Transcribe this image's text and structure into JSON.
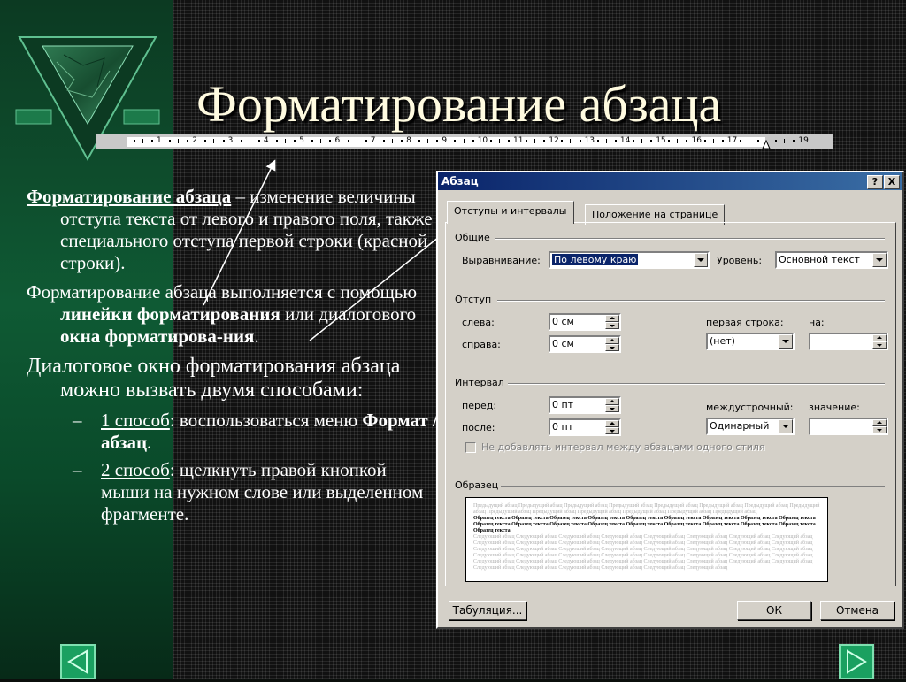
{
  "slide": {
    "title": "Форматирование абзаца",
    "ruler_numbers": [
      "1",
      "2",
      "3",
      "4",
      "5",
      "6",
      "7",
      "8",
      "9",
      "10",
      "11",
      "12",
      "13",
      "14",
      "15",
      "16",
      "17",
      "19"
    ],
    "p1_term": "Форматирование абзаца",
    "p1_rest": " – изменение величины отступа текста от левого и правого поля,  также специального отступа первой строки (красной строки).",
    "p2_a": "Форматирование абзаца выполняется с помощью ",
    "p2_b": "линейки форматирования",
    "p2_c": " или диалогового ",
    "p2_d": "окна форматирова-ния",
    "p2_e": ".",
    "p3": "Диалоговое окно форматирования абзаца можно вызвать двумя способами:",
    "s1_a": "1 способ",
    "s1_b": ":  воспользоваться меню ",
    "s1_c": "Формат / абзац",
    "s1_d": ".",
    "s2_a": "2 способ",
    "s2_b": ": щелкнуть правой кнопкой мыши на нужном слове или выделенном фрагменте.",
    "dash": "–"
  },
  "dialog": {
    "title": "Абзац",
    "help_btn": "?",
    "close_btn": "X",
    "tab1": "Отступы и интервалы",
    "tab2": "Положение на странице",
    "grp_general": "Общие",
    "align_label": "Выравнивание:",
    "align_value": "По левому краю",
    "level_label": "Уровень:",
    "level_value": "Основной текст",
    "grp_indent": "Отступ",
    "left_label": "слева:",
    "left_value": "0 см",
    "right_label": "справа:",
    "right_value": "0 см",
    "first_line_label": "первая строка:",
    "first_line_value": "(нет)",
    "on_label": "на:",
    "on_value": "",
    "grp_interval": "Интервал",
    "before_label": "перед:",
    "before_value": "0 пт",
    "after_label": "после:",
    "after_value": "0 пт",
    "line_label": "междустрочный:",
    "line_value": "Одинарный",
    "value_label": "значение:",
    "value_value": "",
    "no_space_label": "Не добавлять интервал между абзацами одного стиля",
    "grp_sample": "Образец",
    "sample_prev": "Предыдущий абзац Предыдущий абзац Предыдущий абзац Предыдущий абзац Предыдущий абзац Предыдущий абзац Предыдущий абзац Предыдущий абзац Предыдущий абзац Предыдущий абзац Предыдущий абзац Предыдущий абзац Предыдущий абзац Предыдущий абзац",
    "sample_text": "Образец текста Образец текста Образец текста Образец текста Образец текста Образец текста Образец текста Образец текста Образец текста Образец текста Образец текста Образец текста Образец текста Образец текста Образец текста Образец текста Образец текста Образец текста Образец текста",
    "sample_next": "Следующий абзац Следующий абзац Следующий абзац Следующий абзац Следующий абзац Следующий абзац Следующий абзац Следующий абзац Следующий абзац Следующий абзац Следующий абзац Следующий абзац Следующий абзац Следующий абзац Следующий абзац Следующий абзац Следующий абзац Следующий абзац Следующий абзац Следующий абзац Следующий абзац Следующий абзац Следующий абзац Следующий абзац Следующий абзац Следующий абзац Следующий абзац Следующий абзац Следующий абзац Следующий абзац Следующий абзац Следующий абзац Следующий абзац Следующий абзац Следующий абзац Следующий абзац Следующий абзац Следующий абзац Следующий абзац Следующий абзац Следующий абзац Следующий абзац Следующий абзац Следующий абзац Следующий абзац Следующий абзац",
    "tabs_btn": "Табуляция...",
    "ok_btn": "ОК",
    "cancel_btn": "Отмена"
  },
  "nav": {
    "prev_icon": "triangle-left-icon",
    "next_icon": "triangle-right-icon"
  },
  "colors": {
    "title": "#fffbe0",
    "panel_green": "#0f5a34",
    "dialog_face": "#d4d0c8",
    "titlebar": "#0a246a"
  }
}
